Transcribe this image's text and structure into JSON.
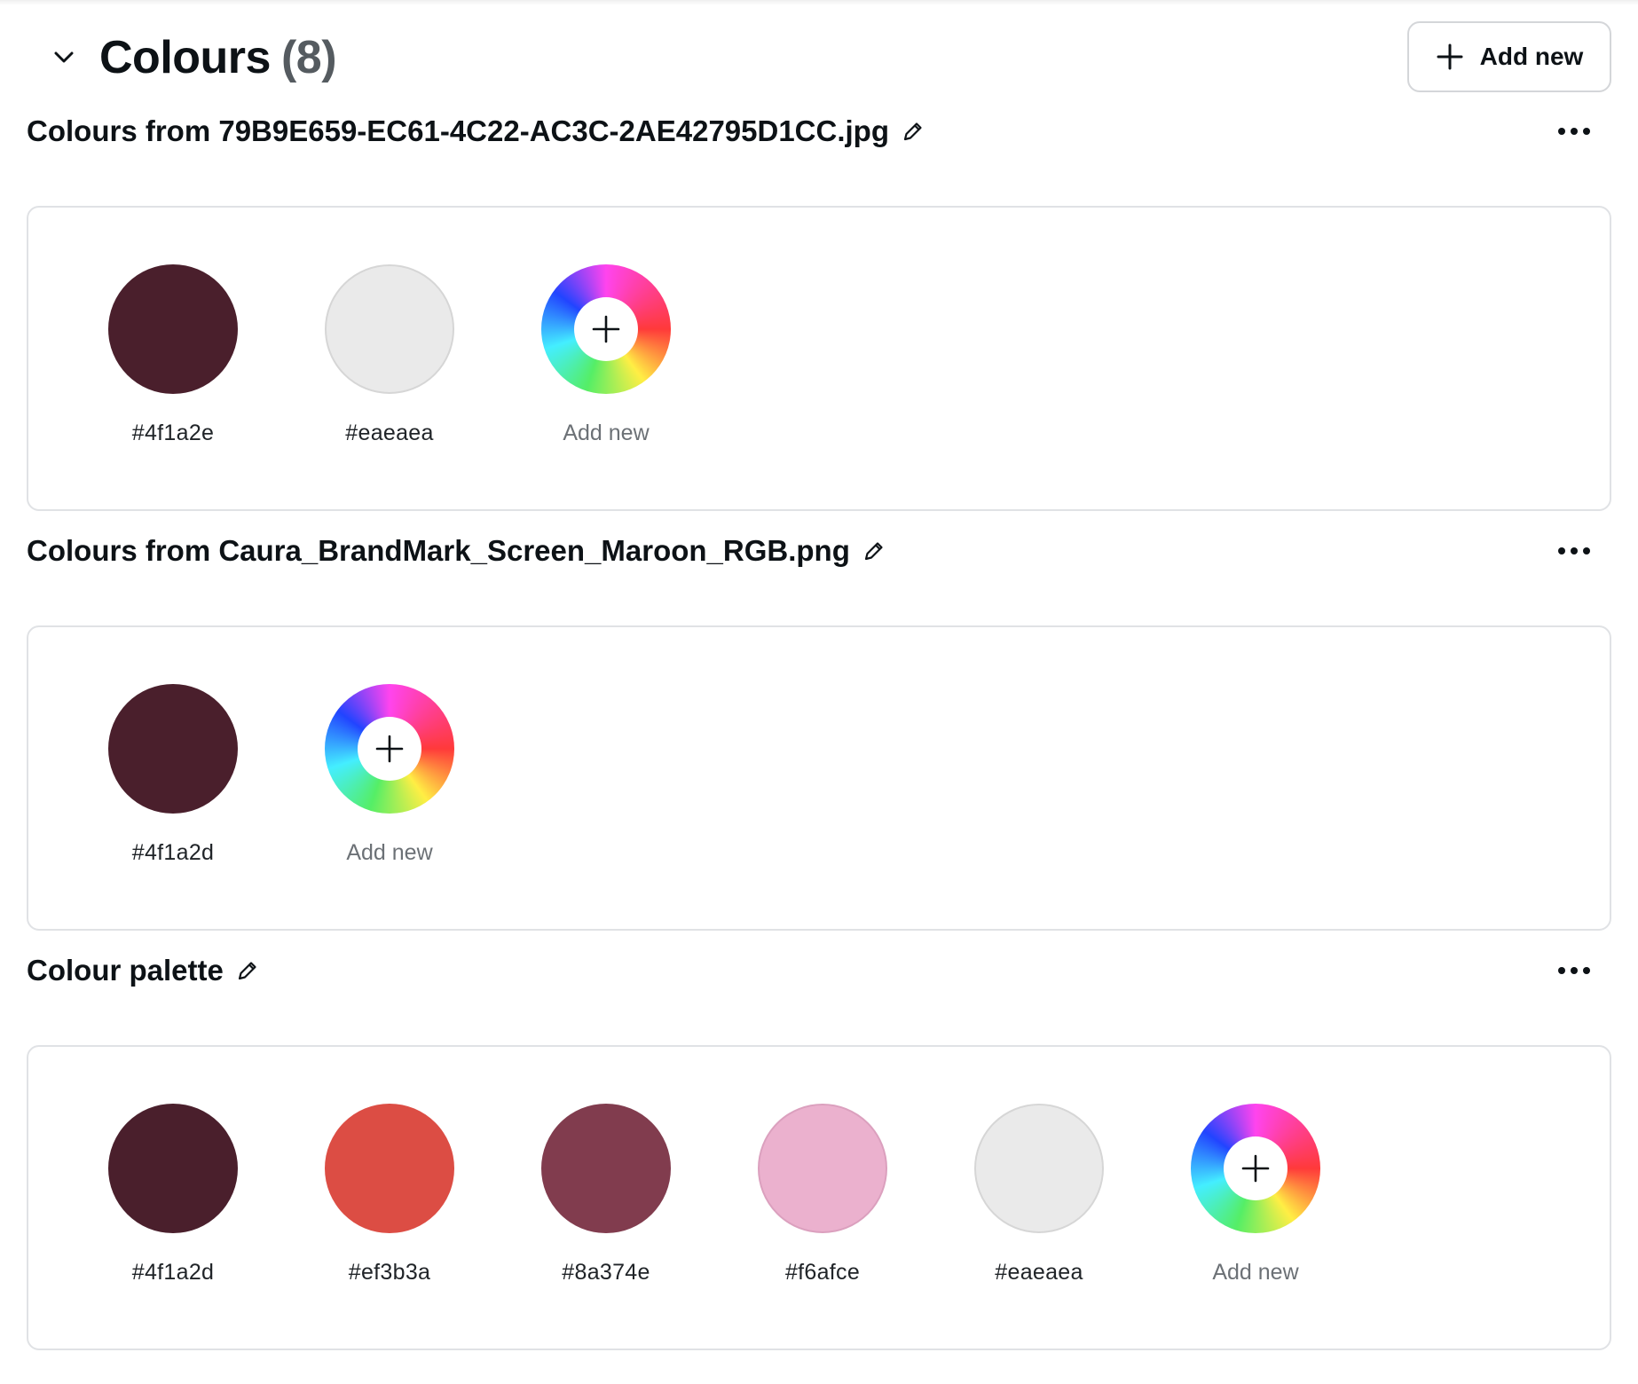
{
  "header": {
    "title": "Colours",
    "count": "(8)",
    "add_new_label": "Add new"
  },
  "groups": [
    {
      "title": "Colours from 79B9E659-EC61-4C22-AC3C-2AE42795D1CC.jpg",
      "swatches": [
        {
          "hex": "#4f1a2e",
          "color": "#4a1f2c"
        },
        {
          "hex": "#eaeaea",
          "color": "#eaeaea"
        }
      ],
      "add_label": "Add new"
    },
    {
      "title": "Colours from Caura_BrandMark_Screen_Maroon_RGB.png",
      "swatches": [
        {
          "hex": "#4f1a2d",
          "color": "#4a1f2c"
        }
      ],
      "add_label": "Add new"
    },
    {
      "title": "Colour palette",
      "swatches": [
        {
          "hex": "#4f1a2d",
          "color": "#4a1f2c"
        },
        {
          "hex": "#ef3b3a",
          "color": "#dc4d44"
        },
        {
          "hex": "#8a374e",
          "color": "#813c4e"
        },
        {
          "hex": "#f6afce",
          "color": "#ebb1ce"
        },
        {
          "hex": "#eaeaea",
          "color": "#eaeaea"
        }
      ],
      "add_label": "Add new"
    }
  ]
}
